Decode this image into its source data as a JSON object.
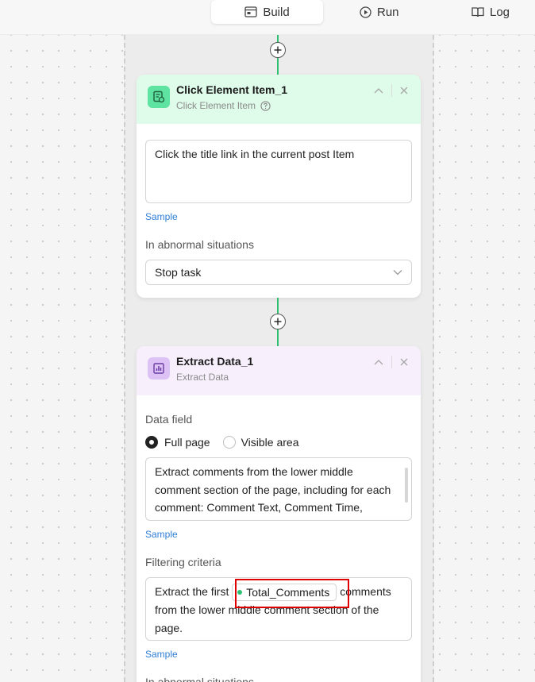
{
  "tabs": [
    {
      "label": "Build",
      "icon": "build-icon",
      "active": true
    },
    {
      "label": "Run",
      "icon": "play-circle-icon",
      "active": false
    },
    {
      "label": "Log",
      "icon": "book-icon",
      "active": false
    }
  ],
  "click_card": {
    "title": "Click Element Item_1",
    "subtitle": "Click Element Item",
    "icon": "click-element-icon",
    "instruction": "Click the title link in the current post Item",
    "sample_link": "Sample",
    "abnormal_label": "In abnormal situations",
    "abnormal_value": "Stop task"
  },
  "extract_card": {
    "title": "Extract Data_1",
    "subtitle": "Extract Data",
    "icon": "extract-data-icon",
    "data_field_label": "Data field",
    "radio_options": [
      "Full page",
      "Visible area"
    ],
    "selected_option": "Full page",
    "instruction": "Extract comments from the lower middle comment section of the page, including for each comment: Comment Text, Comment Time,",
    "sample_link": "Sample",
    "filter_label": "Filtering criteria",
    "filter_prefix": "Extract the first",
    "filter_variable": "Total_Comments",
    "filter_suffix": "comments from the lower middle comment section of the page.",
    "sample_link_2": "Sample",
    "abnormal_label": "In abnormal situations"
  },
  "colors": {
    "connector": "#2fbf71",
    "click_header_bg": "#dffbea",
    "extract_header_bg": "#f7effc",
    "link": "#2f7fd6",
    "highlight": "#e00000"
  }
}
